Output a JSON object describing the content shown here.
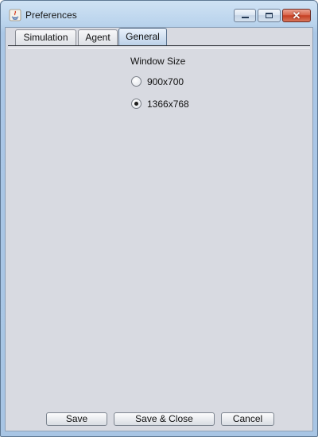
{
  "window": {
    "title": "Preferences",
    "icon": "java-icon",
    "controls": {
      "minimize": "minimize-icon",
      "maximize": "maximize-icon",
      "close": "close-icon",
      "close_glyph": "✕"
    }
  },
  "tabs": [
    {
      "label": "Simulation",
      "selected": false
    },
    {
      "label": "Agent",
      "selected": false
    },
    {
      "label": "General",
      "selected": true
    }
  ],
  "general": {
    "section_label": "Window Size",
    "options": [
      {
        "label": "900x700",
        "selected": false
      },
      {
        "label": "1366x768",
        "selected": true
      }
    ]
  },
  "buttons": {
    "save": "Save",
    "save_close": "Save & Close",
    "cancel": "Cancel"
  }
}
